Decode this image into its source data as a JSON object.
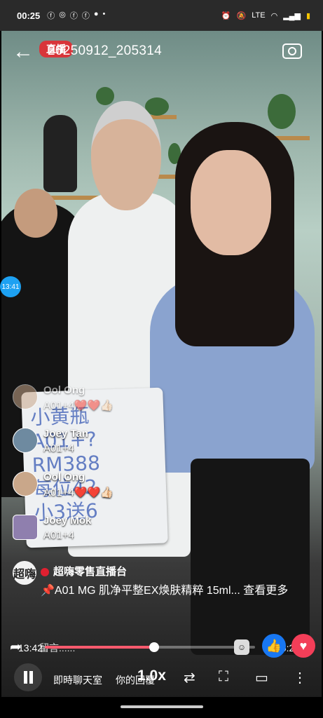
{
  "status_bar": {
    "time": "00:25",
    "app_icons": [
      "facebook-icon",
      "messenger-icon",
      "facebook-icon",
      "facebook-icon",
      "chat-icon",
      "dot"
    ],
    "system_icons": [
      "alarm-icon",
      "mute-icon",
      "volte-icon",
      "wifi-icon",
      "signal-icon",
      "battery-icon"
    ]
  },
  "video_header": {
    "live_badge": "直播",
    "title": "20250912_205314"
  },
  "overlay_time": "13:41",
  "comments": [
    {
      "name": "Ool Ong",
      "text": "A01+4❤️❤️👍🏻"
    },
    {
      "name": "Joey Tan",
      "text": "A01+4"
    },
    {
      "name": "Ool Ong",
      "text": "A01+4❤️❤️👍🏻"
    },
    {
      "name": "Joey Mok",
      "text": "A01+4"
    }
  ],
  "board_text": [
    "小黄瓶",
    "A01+?",
    "RM388",
    "每位42",
    "小3送6"
  ],
  "pinned": {
    "host_avatar_text": "超嗨",
    "host_name": "超嗨零售直播台",
    "message": "📌A01 MG 肌净平整EX焕肤精粹 15ml... 查看更多"
  },
  "playback": {
    "current_time": "13:42",
    "duration": "26:24",
    "comment_placeholder": "留言......",
    "progress": 0.52
  },
  "controls": {
    "live_chat_tab": "即時聊天室",
    "your_replies_tab": "你的回覆",
    "speed": "1.0x"
  },
  "colors": {
    "live_red": "#d8353a",
    "progress_pink": "#ff5a6e",
    "like_blue": "#1877f2",
    "love_red": "#f33e58"
  }
}
